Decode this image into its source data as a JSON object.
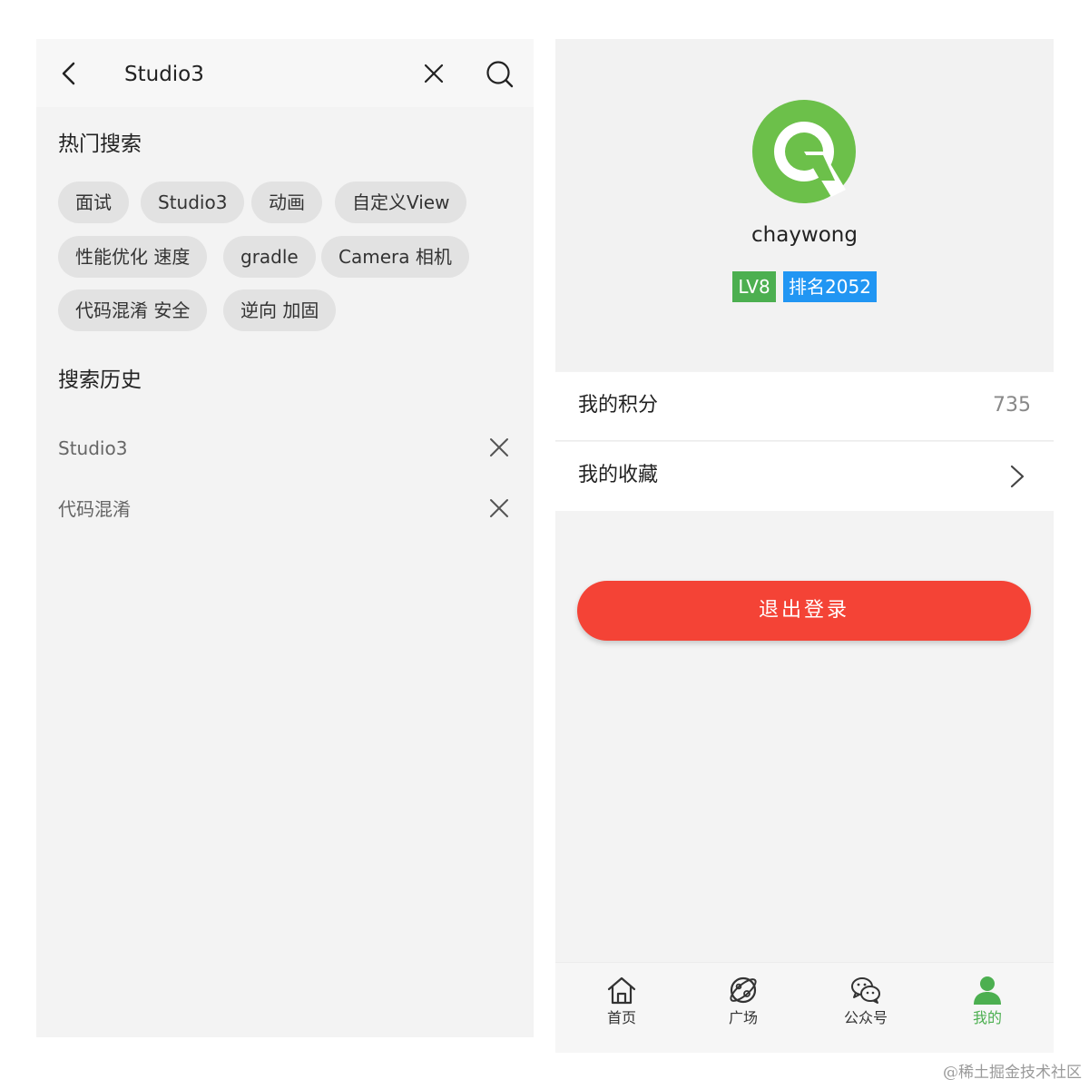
{
  "search_screen": {
    "query": "Studio3",
    "hot_title": "热门搜索",
    "hot_tags": [
      "面试",
      "Studio3",
      "动画",
      "自定义View",
      "性能优化 速度",
      "gradle",
      "Camera 相机",
      "代码混淆 安全",
      "逆向 加固"
    ],
    "history_title": "搜索历史",
    "history": [
      "Studio3",
      "代码混淆"
    ],
    "icons": {
      "back": "chevron-left-icon",
      "clear": "close-icon",
      "search": "search-icon",
      "remove": "close-icon"
    }
  },
  "profile_screen": {
    "username": "chaywong",
    "level": "LV8",
    "rank": "排名2052",
    "menu": {
      "points_label": "我的积分",
      "points_value": "735",
      "favorites_label": "我的收藏"
    },
    "logout_label": "退出登录",
    "nav": [
      {
        "label": "首页",
        "icon": "home-icon"
      },
      {
        "label": "广场",
        "icon": "planet-icon"
      },
      {
        "label": "公众号",
        "icon": "wechat-icon"
      },
      {
        "label": "我的",
        "icon": "user-icon",
        "active": true
      }
    ]
  },
  "colors": {
    "accent_green": "#4caf50",
    "rank_blue": "#2196f3",
    "logout_red": "#f44336"
  },
  "watermark": "@稀土掘金技术社区"
}
